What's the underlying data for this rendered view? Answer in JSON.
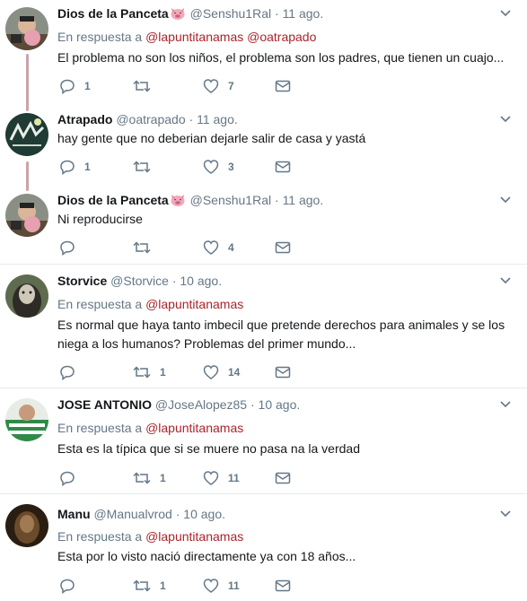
{
  "tweets": [
    {
      "name": "Dios de la Panceta",
      "has_pig": true,
      "handle": "@Senshu1Ral",
      "time": "11 ago.",
      "reply_prefix": "En respuesta a",
      "mentions": "@lapuntitanamas @oatrapado",
      "text": "El problema no son los niños, el problema son los padres, que tienen un cuajo...",
      "replies": "1",
      "retweets": "",
      "likes": "7",
      "avatar": "panceta"
    },
    {
      "name": "Atrapado",
      "has_pig": false,
      "handle": "@oatrapado",
      "time": "11 ago.",
      "reply_prefix": "",
      "mentions": "",
      "text": "hay gente que no deberian dejarle salir de casa y yastá",
      "replies": "1",
      "retweets": "",
      "likes": "3",
      "avatar": "atrapado"
    },
    {
      "name": "Dios de la Panceta",
      "has_pig": true,
      "handle": "@Senshu1Ral",
      "time": "11 ago.",
      "reply_prefix": "",
      "mentions": "",
      "text": "Ni reproducirse",
      "replies": "",
      "retweets": "",
      "likes": "4",
      "avatar": "panceta"
    },
    {
      "name": "Storvice",
      "has_pig": false,
      "handle": "@Storvice",
      "time": "10 ago.",
      "reply_prefix": "En respuesta a",
      "mentions": "@lapuntitanamas",
      "text": "Es normal que haya tanto imbecil que pretende derechos para animales y se los niega a los humanos? Problemas del primer mundo...",
      "replies": "",
      "retweets": "1",
      "likes": "14",
      "avatar": "storvice"
    },
    {
      "name": "JOSE ANTONIO",
      "has_pig": false,
      "handle": "@JoseAlopez85",
      "time": "10 ago.",
      "reply_prefix": "En respuesta a",
      "mentions": "@lapuntitanamas",
      "text": "Esta es la típica que si se muere no pasa na la verdad",
      "replies": "",
      "retweets": "1",
      "likes": "11",
      "avatar": "jose"
    },
    {
      "name": "Manu",
      "has_pig": false,
      "handle": "@Manualvrod",
      "time": "10 ago.",
      "reply_prefix": "En respuesta a",
      "mentions": "@lapuntitanamas",
      "text": "Esta por lo visto nació directamente ya con 18 años...",
      "replies": "",
      "retweets": "1",
      "likes": "11",
      "avatar": "manu"
    }
  ],
  "colors": {
    "mention": "#a8252c",
    "muted": "#657786",
    "thread_line": "#c9a4a8"
  },
  "icons": [
    "reply-icon",
    "retweet-icon",
    "like-icon",
    "direct-message-icon",
    "chevron-down-icon",
    "pig-emoji-icon"
  ]
}
